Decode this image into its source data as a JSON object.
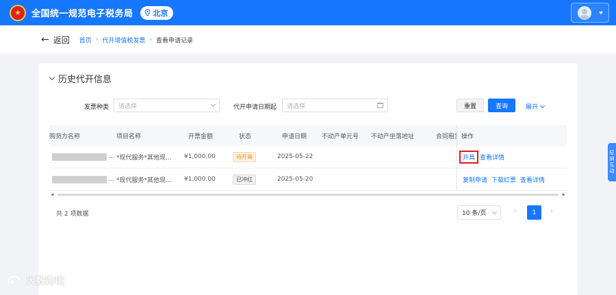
{
  "header": {
    "site_title": "全国统一规范电子税务局",
    "region": "北京",
    "emblem_icon": "national-emblem-icon",
    "pin_icon": "location-pin-icon",
    "avatar_icon": "user-avatar-icon"
  },
  "nav": {
    "back_label": "返回",
    "breadcrumbs": [
      "首页",
      "代开增值税发票",
      "查看申请记录"
    ]
  },
  "section": {
    "title": "历史代开信息"
  },
  "filters": {
    "invoice_type_label": "发票种类",
    "invoice_type_placeholder": "请选择",
    "apply_date_label": "代开申请日期起",
    "apply_date_placeholder": "请选择",
    "reset_label": "重置",
    "query_label": "查询",
    "expand_label": "展开"
  },
  "table": {
    "columns": [
      "购货方名称",
      "项目名称",
      "开票金额",
      "状态",
      "申请日期",
      "不动产单元号",
      "不动产坐落地址",
      "合同租赁",
      "操作"
    ],
    "rows": [
      {
        "buyer_suffix": "...",
        "project": "*现代服务*其他现...",
        "amount": "¥1,000.00",
        "status": "待开具",
        "date": "2025-05-22",
        "actions": [
          "开具",
          "查看详情"
        ]
      },
      {
        "buyer_suffix": "...",
        "project": "*现代服务*其他现...",
        "amount": "¥1,000.00",
        "status": "已冲红",
        "date": "2025-05-20",
        "actions": [
          "复制申请",
          "下载红票",
          "查看详情"
        ]
      }
    ]
  },
  "pagination": {
    "total_text": "共 2 项数据",
    "page_size": "10 条/页",
    "current_page": "1"
  },
  "side_tab": {
    "chars": [
      "征",
      "纳",
      "互",
      "动"
    ]
  },
  "watermark": {
    "text": "大数跨境"
  },
  "colors": {
    "primary": "#1677ff",
    "pending": "#fa8c16",
    "highlight": "#e0191f"
  }
}
